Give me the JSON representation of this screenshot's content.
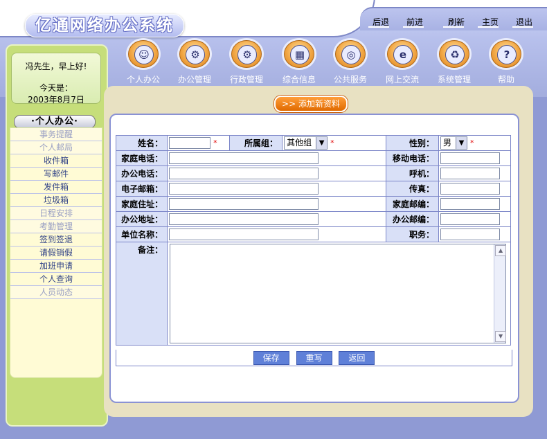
{
  "app": {
    "title": "亿通网络办公系统"
  },
  "top_nav": [
    "后退",
    "前进",
    "刷新",
    "主页",
    "退出"
  ],
  "icon_menu": [
    {
      "label": "个人办公",
      "icon": "person-icon",
      "glyph": "☺"
    },
    {
      "label": "办公管理",
      "icon": "gear-icon",
      "glyph": "⚙"
    },
    {
      "label": "行政管理",
      "icon": "gears-icon",
      "glyph": "⚙"
    },
    {
      "label": "综合信息",
      "icon": "windows-icon",
      "glyph": "▦"
    },
    {
      "label": "公共服务",
      "icon": "globe-icon",
      "glyph": "◎"
    },
    {
      "label": "网上交流",
      "icon": "internet-e-icon",
      "glyph": "e"
    },
    {
      "label": "系统管理",
      "icon": "recycle-icon",
      "glyph": "♻"
    },
    {
      "label": "帮助",
      "icon": "help-icon",
      "glyph": "?"
    }
  ],
  "greeting": {
    "line": "冯先生，早上好!",
    "today_label": "今天是：",
    "date": "2003年8月7日"
  },
  "sidebar": {
    "section_title": "·个人办公·",
    "items": [
      {
        "label": "事务提醒",
        "dim": true
      },
      {
        "label": "个人邮局",
        "dim": true
      },
      {
        "label": "收件箱",
        "dim": false
      },
      {
        "label": "写邮件",
        "dim": false
      },
      {
        "label": "发件箱",
        "dim": false
      },
      {
        "label": "垃圾箱",
        "dim": false
      },
      {
        "label": "日程安排",
        "dim": true
      },
      {
        "label": "考勤管理",
        "dim": true
      },
      {
        "label": "签到签退",
        "dim": false
      },
      {
        "label": "请假销假",
        "dim": false
      },
      {
        "label": "加班申请",
        "dim": false
      },
      {
        "label": "个人查询",
        "dim": false
      },
      {
        "label": "人员动态",
        "dim": true
      }
    ]
  },
  "main": {
    "add_button": ">> 添加新资料",
    "form": {
      "name_label": "姓名：",
      "group_label": "所属组：",
      "group_value": "其他组",
      "gender_label": "性别：",
      "gender_value": "男",
      "required_mark": "*",
      "home_phone_label": "家庭电话：",
      "mobile_label": "移动电话：",
      "office_phone_label": "办公电话：",
      "pager_label": "呼机：",
      "email_label": "电子邮箱：",
      "fax_label": "传真：",
      "home_address_label": "家庭住址：",
      "home_zip_label": "家庭邮编：",
      "office_address_label": "办公地址：",
      "office_zip_label": "办公邮编：",
      "company_label": "单位名称：",
      "position_label": "职务：",
      "remark_label": "备注："
    },
    "buttons": {
      "save": "保存",
      "reset": "重写",
      "back": "返回"
    }
  },
  "colors": {
    "accent": "#8f9ad4",
    "sidebar": "#c6de7a",
    "button": "#5f80d8",
    "orange": "#f08a1c"
  }
}
